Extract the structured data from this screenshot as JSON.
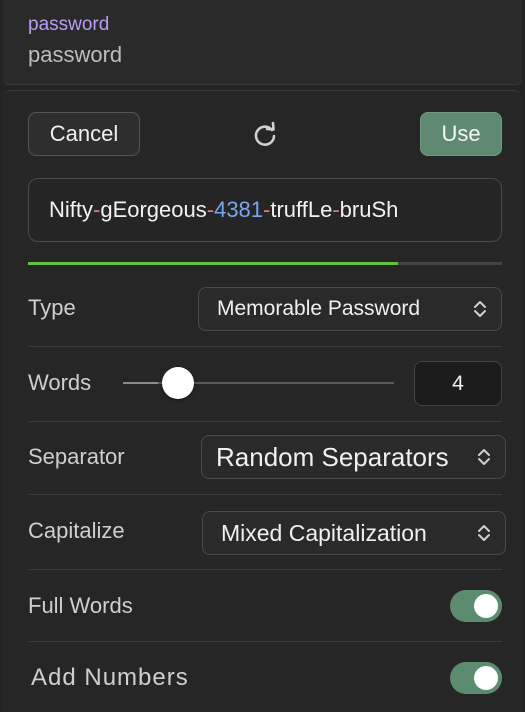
{
  "header_field": {
    "label": "password",
    "value": "password"
  },
  "toolbar": {
    "cancel_label": "Cancel",
    "use_label": "Use",
    "refresh_icon": "refresh-icon"
  },
  "generated": {
    "parts": [
      "Nifty",
      "-",
      "gEorgeous",
      "-",
      "4381",
      "-",
      "truffLe",
      "-",
      "bruSh"
    ],
    "strength_fraction": 0.78
  },
  "options": {
    "type": {
      "label": "Type",
      "value": "Memorable Password"
    },
    "words": {
      "label": "Words",
      "value": "4",
      "slider_fraction": 0.13
    },
    "separator": {
      "label": "Separator",
      "value": "Random Separators"
    },
    "capitalize": {
      "label": "Capitalize",
      "value": "Mixed Capitalization"
    },
    "full_words": {
      "label": "Full Words",
      "on": true
    },
    "add_numbers": {
      "label": "Add Numbers",
      "on": true
    }
  },
  "colors": {
    "accent_label": "#b89cf5",
    "use_button": "#5f8a71",
    "separator_char": "#e07a75",
    "number": "#7aa7f0",
    "strength": "#62c23b",
    "toggle_on": "#5c8c70"
  }
}
